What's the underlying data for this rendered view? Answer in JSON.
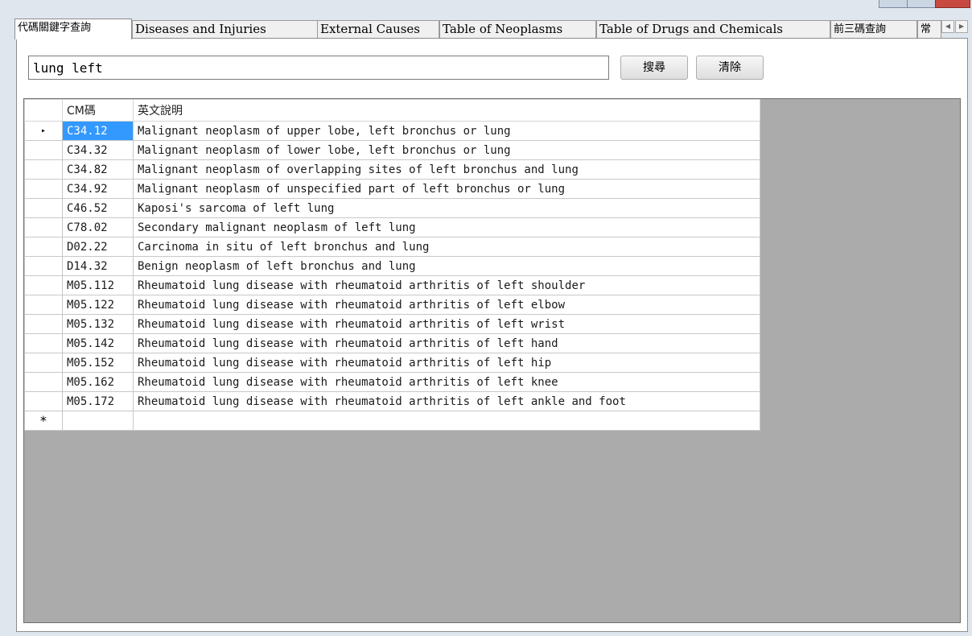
{
  "tabs": [
    {
      "label": "代碼關鍵字查詢",
      "active": true
    },
    {
      "label": "Diseases and Injuries"
    },
    {
      "label": "External Causes"
    },
    {
      "label": "Table of Neoplasms"
    },
    {
      "label": "Table of Drugs and Chemicals"
    },
    {
      "label": "前三碼查詢"
    },
    {
      "label": "常"
    }
  ],
  "search": {
    "value": "lung left"
  },
  "buttons": {
    "search": "搜尋",
    "clear": "清除"
  },
  "grid": {
    "columns": [
      "CM碼",
      "英文說明"
    ],
    "current_row_marker": "▸",
    "new_row_marker": "*",
    "rows": [
      {
        "code": "C34.12",
        "desc": "Malignant neoplasm of upper lobe, left bronchus or lung"
      },
      {
        "code": "C34.32",
        "desc": "Malignant neoplasm of lower lobe, left bronchus or lung"
      },
      {
        "code": "C34.82",
        "desc": "Malignant neoplasm of overlapping sites of left bronchus and lung"
      },
      {
        "code": "C34.92",
        "desc": "Malignant neoplasm of unspecified part of left bronchus or lung"
      },
      {
        "code": "C46.52",
        "desc": "Kaposi's sarcoma of left lung"
      },
      {
        "code": "C78.02",
        "desc": "Secondary malignant neoplasm of left lung"
      },
      {
        "code": "D02.22",
        "desc": "Carcinoma in situ of left bronchus and lung"
      },
      {
        "code": "D14.32",
        "desc": "Benign neoplasm of left bronchus and lung"
      },
      {
        "code": "M05.112",
        "desc": "Rheumatoid lung disease with rheumatoid arthritis of left shoulder"
      },
      {
        "code": "M05.122",
        "desc": "Rheumatoid lung disease with rheumatoid arthritis of left elbow"
      },
      {
        "code": "M05.132",
        "desc": "Rheumatoid lung disease with rheumatoid arthritis of left wrist"
      },
      {
        "code": "M05.142",
        "desc": "Rheumatoid lung disease with rheumatoid arthritis of left hand"
      },
      {
        "code": "M05.152",
        "desc": "Rheumatoid lung disease with rheumatoid arthritis of left hip"
      },
      {
        "code": "M05.162",
        "desc": "Rheumatoid lung disease with rheumatoid arthritis of left knee"
      },
      {
        "code": "M05.172",
        "desc": "Rheumatoid lung disease with rheumatoid arthritis of left ankle and foot"
      }
    ]
  }
}
